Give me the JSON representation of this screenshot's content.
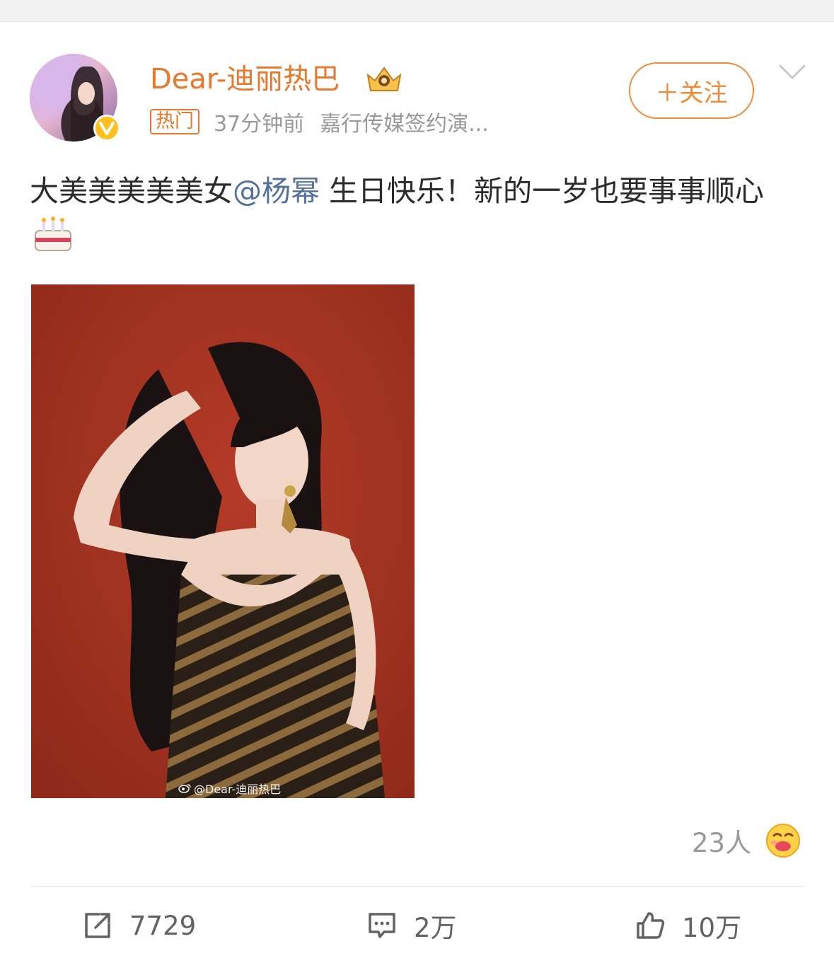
{
  "post": {
    "author": {
      "name": "Dear-迪丽热巴"
    },
    "meta": {
      "hot_tag": "热门",
      "time": "37分钟前",
      "source": "嘉行传媒签约演..."
    },
    "follow_label": "＋关注",
    "text": {
      "before": "大美美美美美女",
      "mention": "@杨幂",
      "after": " 生日快乐！新的一岁也要事事顺心"
    },
    "photo": {
      "watermark": "@Dear-迪丽热巴"
    },
    "reactions": {
      "count_label": "23人"
    },
    "actions": {
      "repost_count": "7729",
      "comment_count": "2万",
      "like_count": "10万"
    }
  },
  "colors": {
    "accent": "#e8782c",
    "mention": "#51709e",
    "photo_background": "#a73422",
    "muted_text": "#999999"
  },
  "icons": [
    "verified-icon",
    "crown-icon",
    "chevron-down-icon",
    "cake-icon",
    "weibo-logo-icon",
    "emoji-icon",
    "repost-icon",
    "comment-icon",
    "like-icon"
  ]
}
